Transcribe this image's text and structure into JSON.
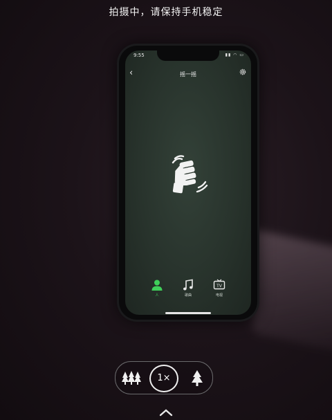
{
  "camera": {
    "instruction": "拍摄中，请保持手机稳定",
    "zoom": {
      "label": "1×",
      "options": [
        "wide-angle",
        "1×",
        "telephoto"
      ]
    }
  },
  "phone": {
    "status_bar": {
      "time": "9:55",
      "icons": "▮▮ ◠ ▭"
    },
    "nav": {
      "title": "摇一摇",
      "back_label": "‹"
    },
    "tabs": [
      {
        "label": "人",
        "icon": "person-icon",
        "active": true
      },
      {
        "label": "歌曲",
        "icon": "music-note-icon",
        "active": false
      },
      {
        "label": "电视",
        "icon": "tv-icon",
        "active": false
      }
    ]
  },
  "colors": {
    "active_green": "#3fcf5a",
    "screen_green": "#2c3830"
  }
}
